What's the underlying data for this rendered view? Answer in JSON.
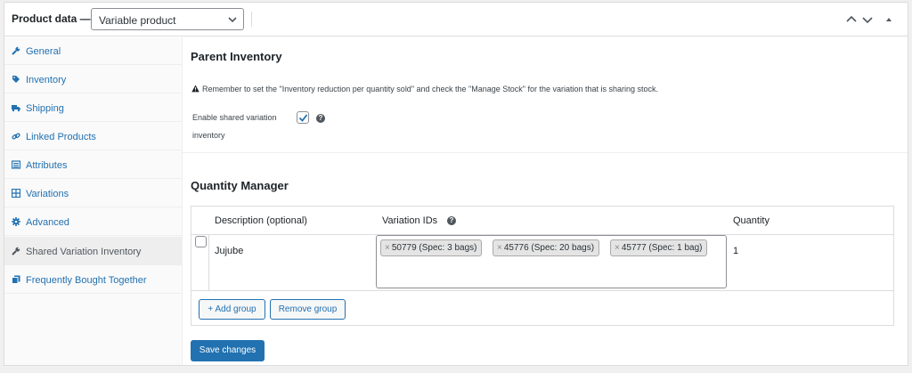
{
  "header": {
    "title": "Product data —",
    "product_type": "Variable product",
    "controls": [
      "move-up-icon",
      "move-down-icon",
      "toggle-panel-icon"
    ]
  },
  "sidebar": {
    "items": [
      {
        "label": "General",
        "icon": "wrench-icon"
      },
      {
        "label": "Inventory",
        "icon": "tag-icon"
      },
      {
        "label": "Shipping",
        "icon": "truck-icon"
      },
      {
        "label": "Linked Products",
        "icon": "link-icon"
      },
      {
        "label": "Attributes",
        "icon": "list-icon"
      },
      {
        "label": "Variations",
        "icon": "grid-icon"
      },
      {
        "label": "Advanced",
        "icon": "gear-icon"
      },
      {
        "label": "Shared Variation Inventory",
        "icon": "wrench-icon",
        "active": true
      },
      {
        "label": "Frequently Bought Together",
        "icon": "copy-icon"
      }
    ]
  },
  "parent_inventory": {
    "heading": "Parent Inventory",
    "notice": "Remember to set the \"Inventory reduction per quantity sold\" and check the \"Manage Stock\" for the variation that is sharing stock.",
    "enable_label_line1": "Enable shared variation",
    "enable_label_line2": "inventory",
    "enable_checked": true
  },
  "quantity_manager": {
    "heading": "Quantity Manager",
    "columns": [
      "Description (optional)",
      "Variation IDs",
      "Quantity"
    ],
    "rows": [
      {
        "checked": false,
        "description": "Jujube",
        "variation_ids": [
          "50779 (Spec: 3 bags)",
          "45776 (Spec: 20 bags)",
          "45777 (Spec: 1 bag)"
        ],
        "quantity": "1"
      }
    ],
    "add_group_label": "+ Add group",
    "remove_group_label": "Remove group"
  },
  "save_label": "Save changes",
  "colors": {
    "accent": "#2271b1",
    "sidebar_bg": "#fafafa",
    "active_tab_bg": "#eeeeee"
  }
}
